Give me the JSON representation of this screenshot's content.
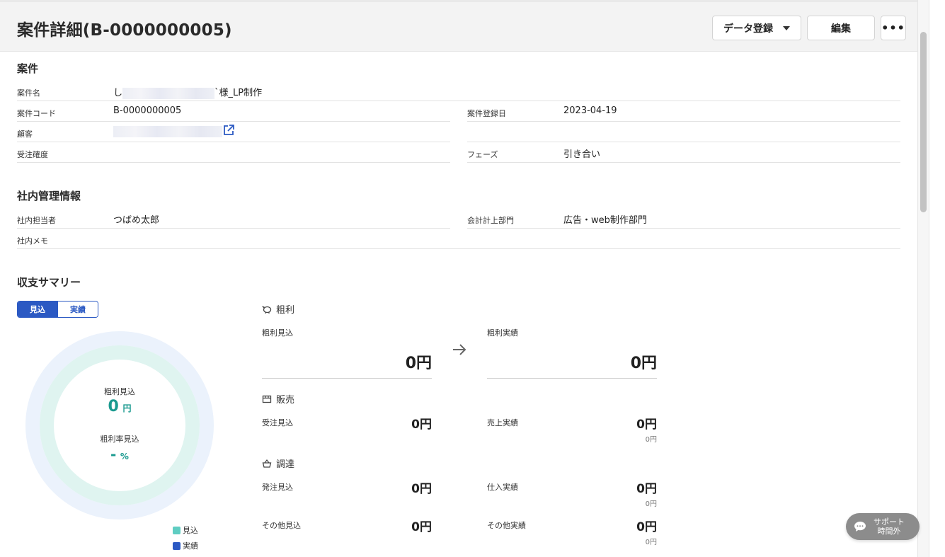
{
  "header": {
    "title": "案件詳細(B-0000000005)",
    "register_label": "データ登録",
    "edit_label": "編集",
    "more_label": "•••"
  },
  "case": {
    "section_title": "案件",
    "name_label": "案件名",
    "name_prefix": "し",
    "name_suffix": "`様_LP制作",
    "code_label": "案件コード",
    "code_value": "B-0000000005",
    "date_label": "案件登録日",
    "date_value": "2023-04-19",
    "customer_label": "顧客",
    "probability_label": "受注確度",
    "phase_label": "フェーズ",
    "phase_value": "引き合い"
  },
  "internal": {
    "section_title": "社内管理情報",
    "owner_label": "社内担当者",
    "owner_value": "つばめ太郎",
    "dept_label": "会計計上部門",
    "dept_value": "広告・web制作部門",
    "memo_label": "社内メモ"
  },
  "summary": {
    "section_title": "収支サマリー",
    "toggle": [
      "見込",
      "実績"
    ],
    "donut": {
      "profit_label": "粗利見込",
      "profit_value": "0",
      "profit_unit": "円",
      "rate_label": "粗利率見込",
      "rate_value": "-",
      "rate_unit": "%",
      "forecast_color": "#5fcdc2",
      "actual_color": "#2b59c3"
    },
    "legend": [
      "見込",
      "実績"
    ],
    "profit": {
      "title": "粗利",
      "forecast_label": "粗利見込",
      "forecast_value": "0円",
      "actual_label": "粗利実績",
      "actual_value": "0円"
    },
    "sales": {
      "title": "販売",
      "forecast_label": "受注見込",
      "forecast_value": "0円",
      "actual_label": "売上実績",
      "actual_value": "0円",
      "actual_sub": "0円"
    },
    "procurement": {
      "title": "調達",
      "order_label": "発注見込",
      "order_value": "0円",
      "purchase_label": "仕入実績",
      "purchase_value": "0円",
      "purchase_sub": "0円",
      "other_forecast_label": "その他見込",
      "other_forecast_value": "0円",
      "other_actual_label": "その他実績",
      "other_actual_value": "0円",
      "other_actual_sub": "0円"
    }
  },
  "support": {
    "line1": "サポート",
    "line2": "時間外"
  }
}
